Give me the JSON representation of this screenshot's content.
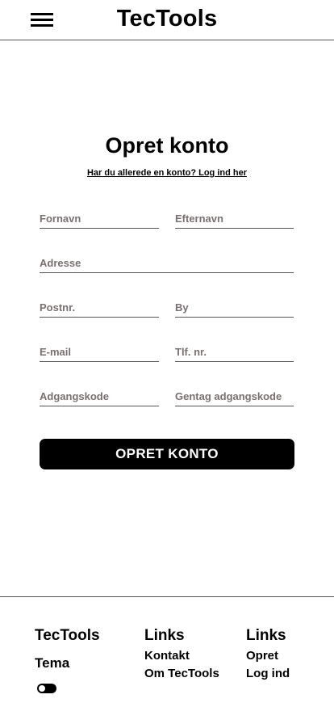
{
  "header": {
    "brand": "TecTools",
    "menu_icon": "hamburger-menu-icon"
  },
  "form": {
    "title": "Opret konto",
    "login_link": "Har du allerede en konto? Log ind her",
    "fields": {
      "first_name": {
        "placeholder": "Fornavn",
        "value": ""
      },
      "last_name": {
        "placeholder": "Efternavn",
        "value": ""
      },
      "address": {
        "placeholder": "Adresse",
        "value": ""
      },
      "postal_code": {
        "placeholder": "Postnr.",
        "value": ""
      },
      "city": {
        "placeholder": "By",
        "value": ""
      },
      "email": {
        "placeholder": "E-mail",
        "value": ""
      },
      "phone": {
        "placeholder": "Tlf. nr.",
        "value": ""
      },
      "password": {
        "placeholder": "Adgangskode",
        "value": ""
      },
      "password_repeat": {
        "placeholder": "Gentag adgangskode",
        "value": ""
      }
    },
    "submit_label": "OPRET KONTO"
  },
  "footer": {
    "brand": "TecTools",
    "theme_label": "Tema",
    "theme_toggle_on": false,
    "links_col1": {
      "heading": "Links",
      "items": [
        "Kontakt",
        "Om TecTools"
      ]
    },
    "links_col2": {
      "heading": "Links",
      "items": [
        "Opret",
        "Log ind"
      ]
    }
  }
}
